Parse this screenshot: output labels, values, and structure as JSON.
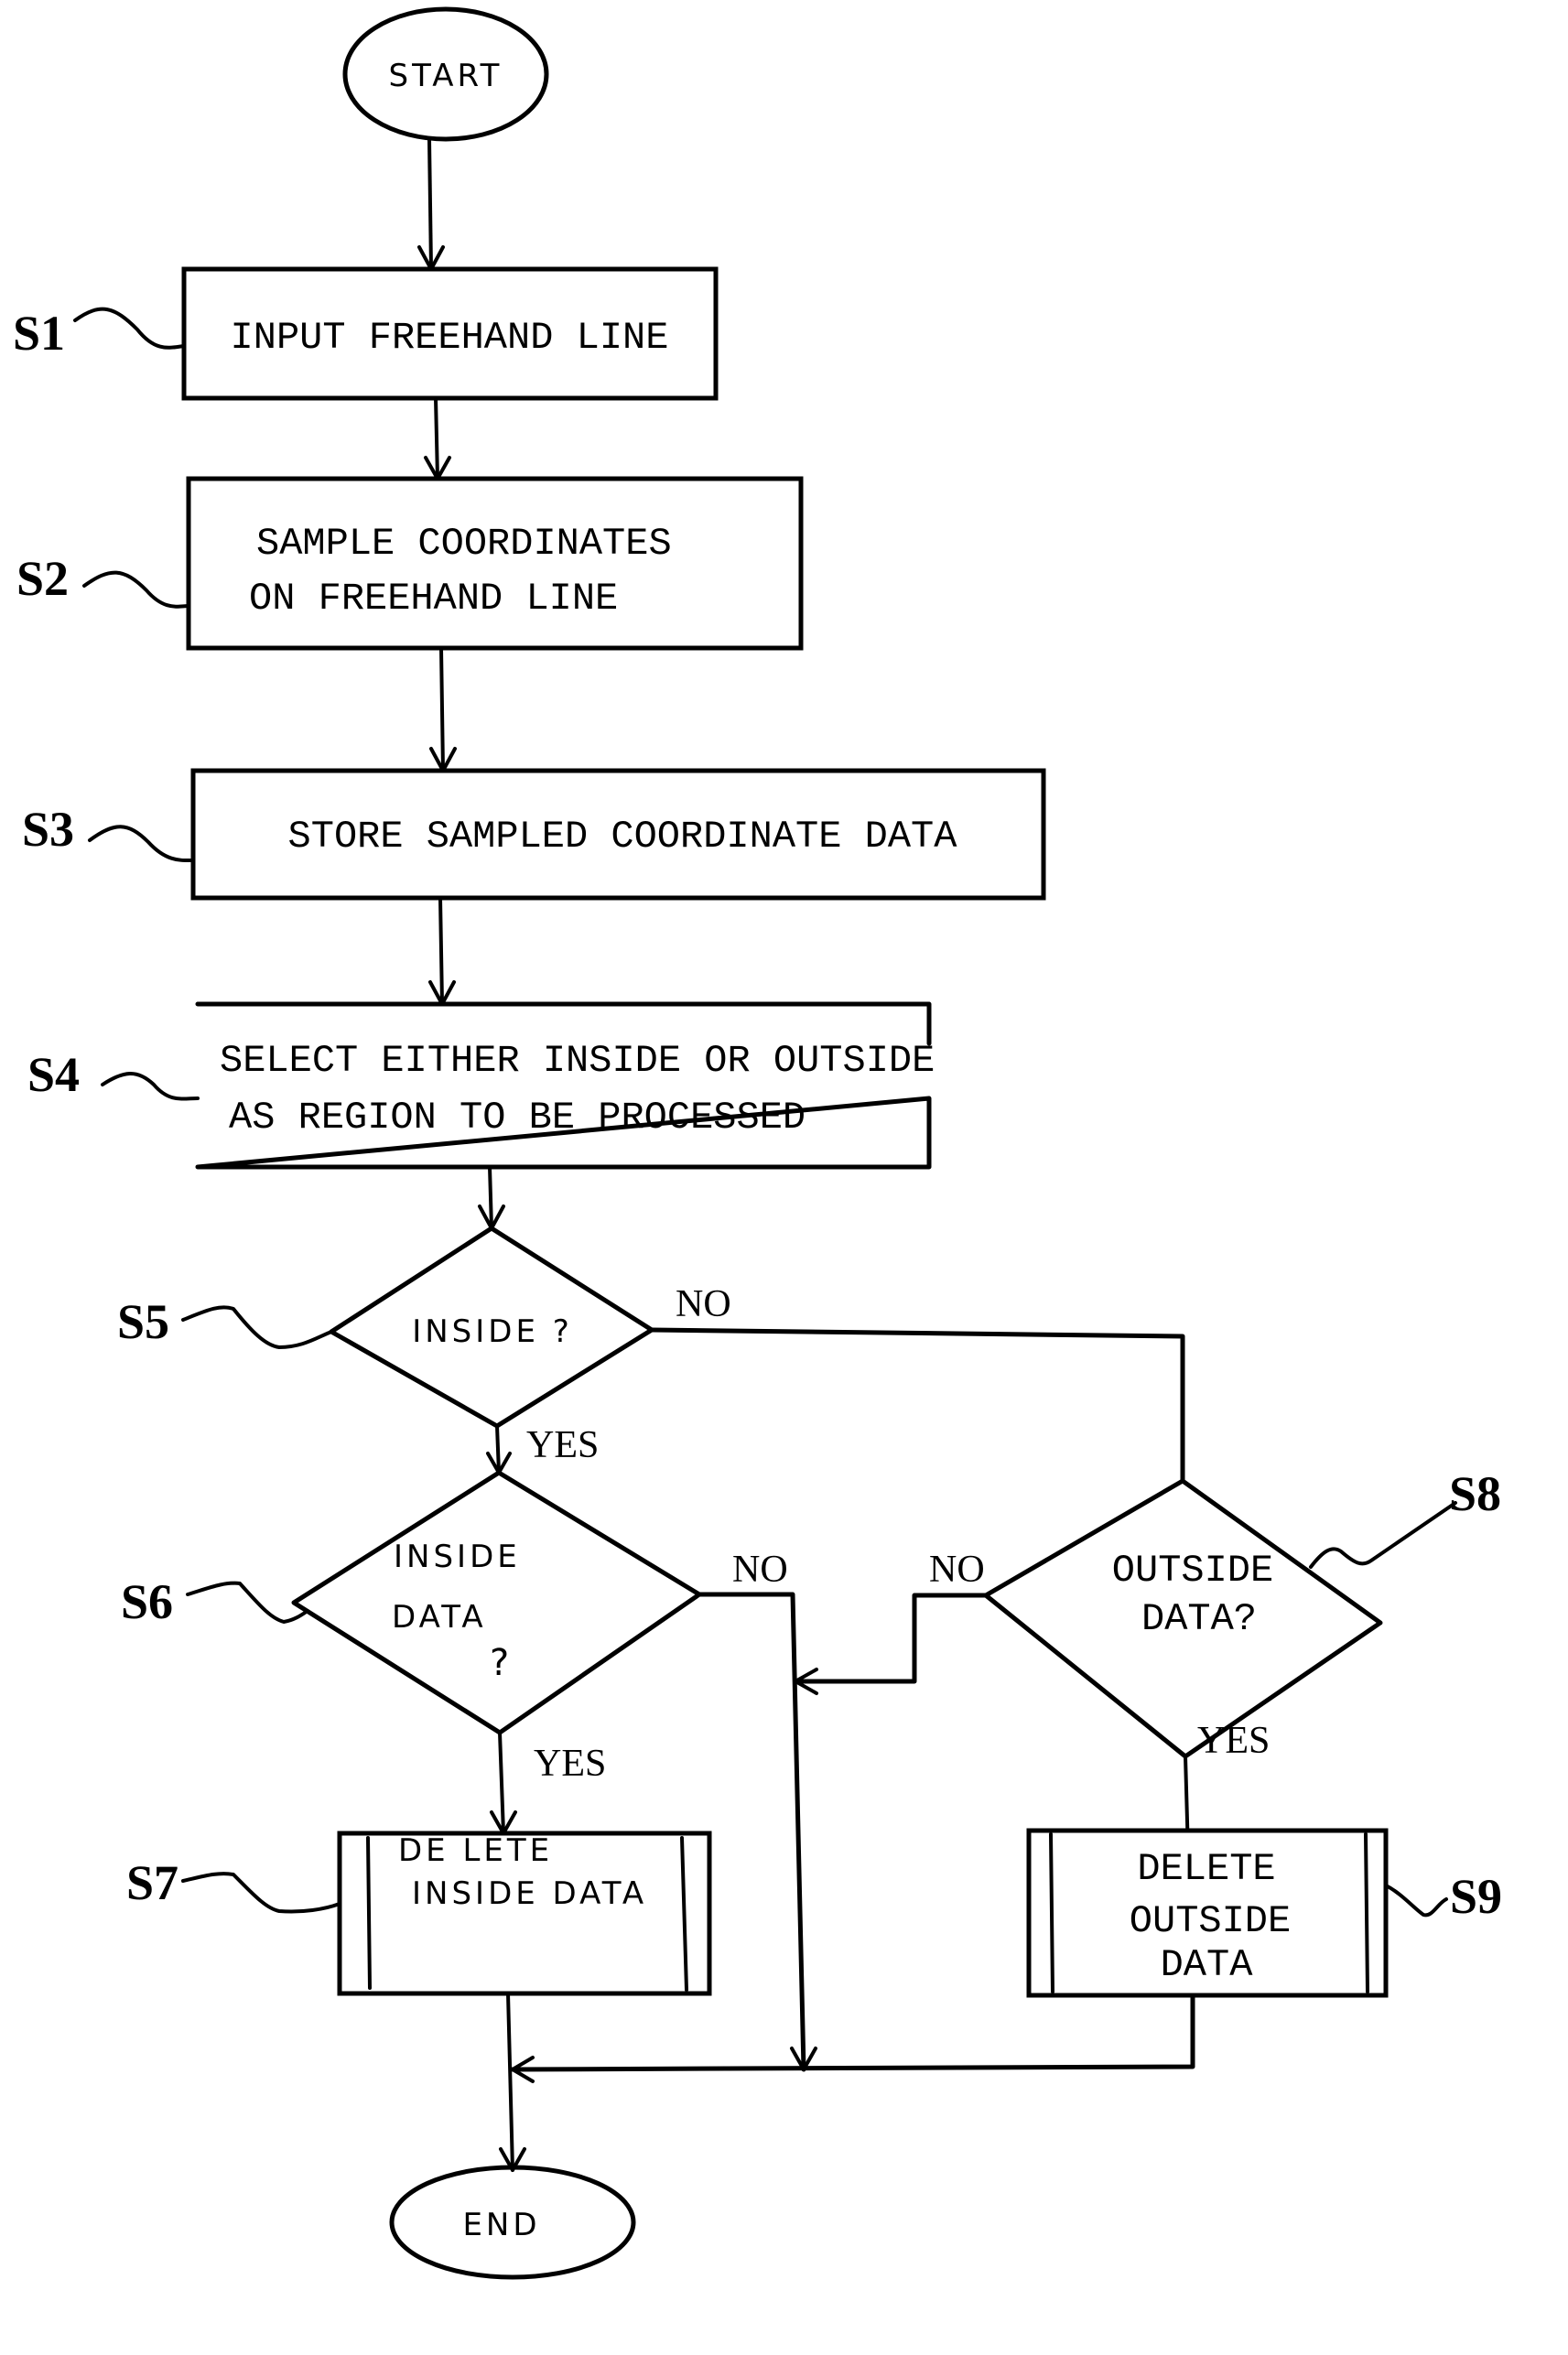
{
  "diagram": {
    "type": "flowchart",
    "terminals": {
      "start": "START",
      "end": "END"
    },
    "steps": [
      {
        "id": "S1",
        "label": "S1",
        "kind": "process",
        "lines": [
          "INPUT FREEHAND LINE"
        ]
      },
      {
        "id": "S2",
        "label": "S2",
        "kind": "process",
        "lines": [
          "SAMPLE COORDINATES",
          "ON FREEHAND LINE"
        ]
      },
      {
        "id": "S3",
        "label": "S3",
        "kind": "process",
        "lines": [
          "STORE SAMPLED COORDINATE DATA"
        ]
      },
      {
        "id": "S4",
        "label": "S4",
        "kind": "process",
        "lines": [
          "SELECT EITHER INSIDE OR OUTSIDE",
          "AS REGION TO BE PROCESSED"
        ]
      },
      {
        "id": "S5",
        "label": "S5",
        "kind": "decision",
        "lines": [
          "INSIDE ?"
        ]
      },
      {
        "id": "S6",
        "label": "S6",
        "kind": "decision",
        "lines": [
          "INSIDE",
          "DATA",
          "?"
        ]
      },
      {
        "id": "S7",
        "label": "S7",
        "kind": "predefined-process",
        "lines": [
          "DE LETE",
          "INSIDE DATA"
        ]
      },
      {
        "id": "S8",
        "label": "S8",
        "kind": "decision",
        "lines": [
          "OUTSIDE",
          "DATA?"
        ]
      },
      {
        "id": "S9",
        "label": "S9",
        "kind": "predefined-process",
        "lines": [
          "DELETE",
          "OUTSIDE",
          "DATA"
        ]
      }
    ],
    "branch_labels": {
      "s5_no": "NO",
      "s5_yes": "YES",
      "s6_no": "NO",
      "s6_yes": "YES",
      "s8_no": "NO",
      "s8_yes": "YES"
    },
    "edges": [
      {
        "from": "START",
        "to": "S1"
      },
      {
        "from": "S1",
        "to": "S2"
      },
      {
        "from": "S2",
        "to": "S3"
      },
      {
        "from": "S3",
        "to": "S4"
      },
      {
        "from": "S4",
        "to": "S5"
      },
      {
        "from": "S5",
        "to": "S6",
        "label": "YES"
      },
      {
        "from": "S5",
        "to": "S8",
        "label": "NO"
      },
      {
        "from": "S6",
        "to": "S7",
        "label": "YES"
      },
      {
        "from": "S6",
        "to": "END",
        "label": "NO"
      },
      {
        "from": "S8",
        "to": "S9",
        "label": "YES"
      },
      {
        "from": "S8",
        "to": "END",
        "label": "NO"
      },
      {
        "from": "S7",
        "to": "END"
      },
      {
        "from": "S9",
        "to": "END"
      }
    ]
  }
}
